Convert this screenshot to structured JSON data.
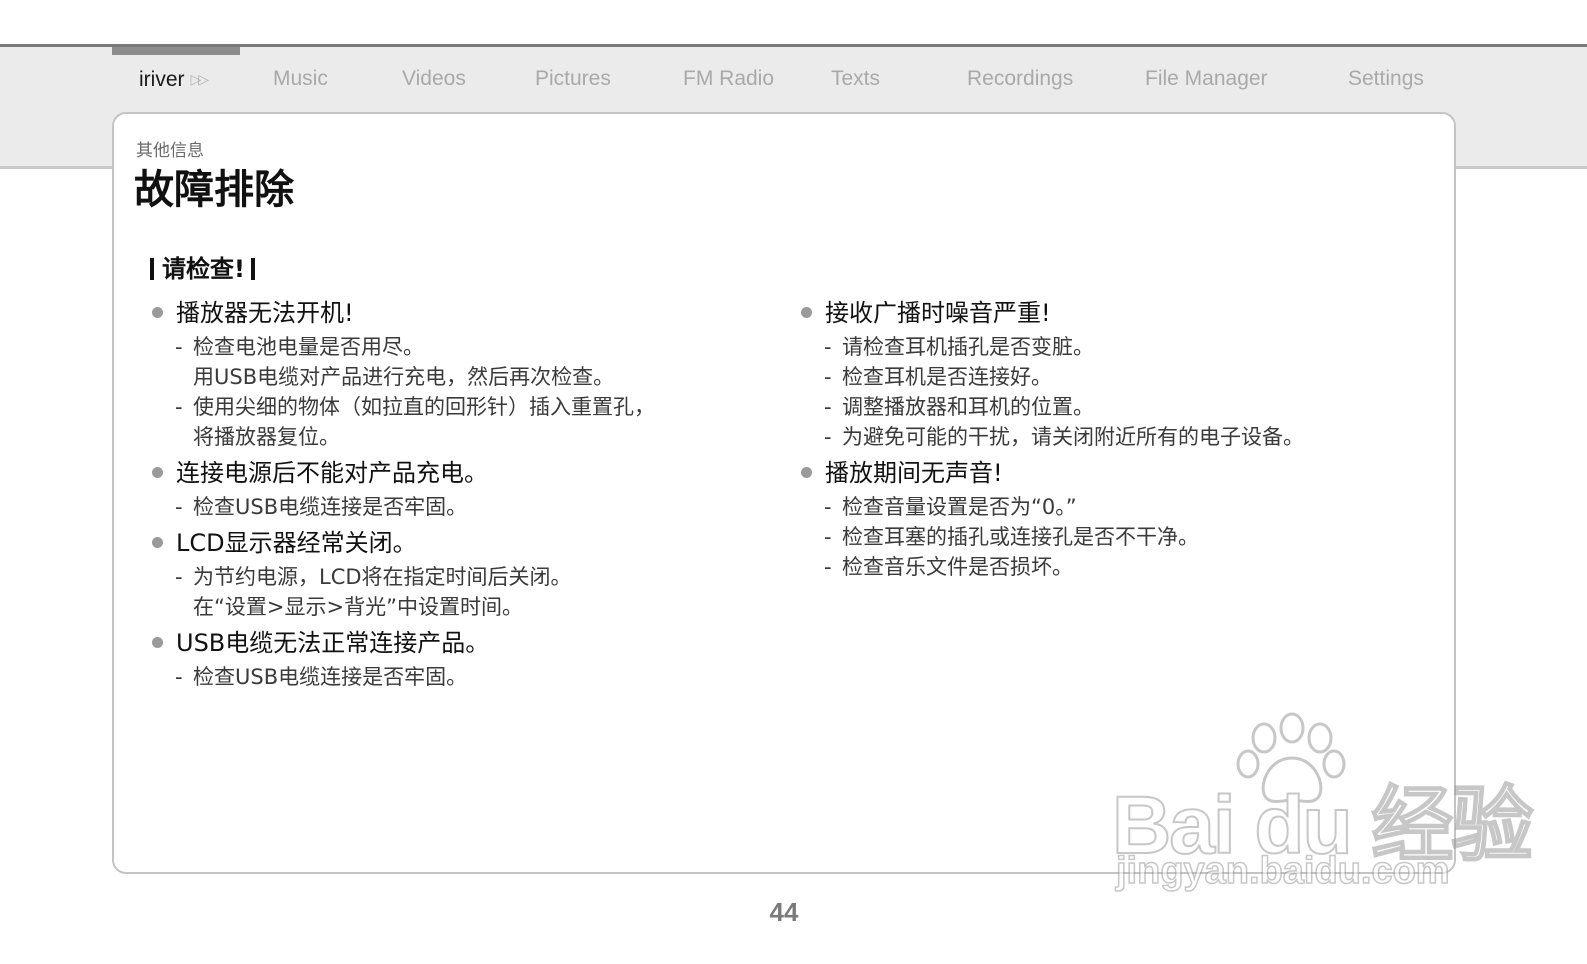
{
  "nav": {
    "brand": "iriver",
    "items": [
      "Music",
      "Videos",
      "Pictures",
      "FM Radio",
      "Texts",
      "Recordings",
      "File Manager",
      "Settings"
    ]
  },
  "page": {
    "category": "其他信息",
    "title": "故障排除",
    "section_heading": "请检查!",
    "page_number": "44"
  },
  "left_items": [
    {
      "title": "播放器无法开机!",
      "lines": [
        {
          "dash": true,
          "text": "检查电池电量是否用尽。"
        },
        {
          "dash": false,
          "text": "用USB电缆对产品进行充电，然后再次检查。"
        },
        {
          "dash": true,
          "text": "使用尖细的物体（如拉直的回形针）插入重置孔，"
        },
        {
          "dash": false,
          "text": "将播放器复位。"
        }
      ]
    },
    {
      "title": "连接电源后不能对产品充电。",
      "lines": [
        {
          "dash": true,
          "text": "检查USB电缆连接是否牢固。"
        }
      ]
    },
    {
      "title": "LCD显示器经常关闭。",
      "lines": [
        {
          "dash": true,
          "text": "为节约电源，LCD将在指定时间后关闭。"
        },
        {
          "dash": false,
          "text": "在“设置>显示>背光”中设置时间。"
        }
      ]
    },
    {
      "title": "USB电缆无法正常连接产品。",
      "lines": [
        {
          "dash": true,
          "text": "检查USB电缆连接是否牢固。"
        }
      ]
    }
  ],
  "right_items": [
    {
      "title": "接收广播时噪音严重!",
      "lines": [
        {
          "dash": true,
          "text": "请检查耳机插孔是否变脏。"
        },
        {
          "dash": true,
          "text": "检查耳机是否连接好。"
        },
        {
          "dash": true,
          "text": "调整播放器和耳机的位置。"
        },
        {
          "dash": true,
          "text": "为避免可能的干扰，请关闭附近所有的电子设备。"
        }
      ]
    },
    {
      "title": "播放期间无声音!",
      "lines": [
        {
          "dash": true,
          "text": "检查音量设置是否为“0。”"
        },
        {
          "dash": true,
          "text": "检查耳塞的插孔或连接孔是否不干净。"
        },
        {
          "dash": true,
          "text": "检查音乐文件是否损坏。"
        }
      ]
    }
  ],
  "watermark": {
    "text": "Bai du 经验",
    "url": "jingyan.baidu.com",
    "icon": "baidu-paw-icon"
  }
}
